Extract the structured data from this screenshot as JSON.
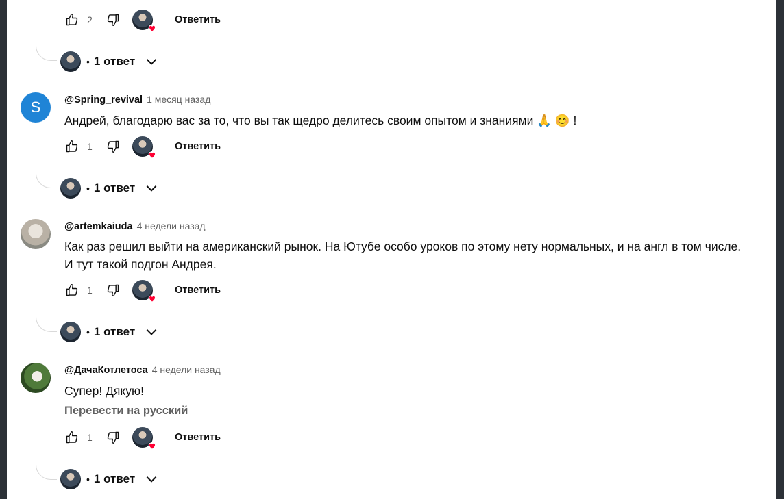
{
  "comments": [
    {
      "author": "",
      "time": "",
      "text": "",
      "likes": "2",
      "reply_label": "Ответить",
      "replies_label": "1 ответ"
    },
    {
      "author": "@Spring_revival",
      "time": "1 месяц назад",
      "avatar_letter": "S",
      "text": "Андрей, благодарю вас за то, что вы так щедро делитесь своим опытом и знаниями 🙏 😊 !",
      "likes": "1",
      "reply_label": "Ответить",
      "replies_label": "1 ответ"
    },
    {
      "author": "@artemkaiuda",
      "time": "4 недели назад",
      "text_line1": "Как раз решил выйти на американский рынок. На Ютубе особо уроков по этому нету нормальных,  и на англ в том числе.",
      "text_line2": "И тут такой подгон Андрея.",
      "likes": "1",
      "reply_label": "Ответить",
      "replies_label": "1 ответ"
    },
    {
      "author": "@ДачаКотлетоса",
      "time": "4 недели назад",
      "text": "Супер! Дякую!",
      "translate_label": "Перевести на русский",
      "likes": "1",
      "reply_label": "Ответить",
      "replies_label": "1 ответ"
    }
  ],
  "colors": {
    "accent_avatar": "#1f84d6",
    "heart": "#ff0033",
    "background": "#ffffff"
  }
}
